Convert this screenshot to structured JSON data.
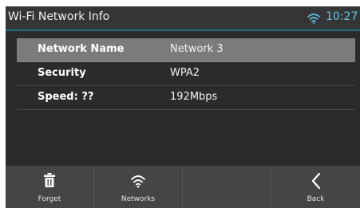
{
  "header": {
    "title": "Wi-Fi Network Info",
    "time": "10:27",
    "status_icon": "wifi-icon"
  },
  "rows": [
    {
      "label": "Network Name",
      "value": "Network 3",
      "selected": true
    },
    {
      "label": "Security",
      "value": "WPA2",
      "selected": false
    },
    {
      "label": "Speed: ??",
      "value": "192Mbps",
      "selected": false
    }
  ],
  "toolbar": {
    "forget_label": "Forget",
    "forget_icon": "trash-icon",
    "networks_label": "Networks",
    "networks_icon": "wifi-icon",
    "back_label": "Back",
    "back_icon": "chevron-left-icon"
  },
  "colors": {
    "accent": "#5ec7e9",
    "header_divider": "#1f6f86",
    "background": "#2b2b2b",
    "selected_row": "#7b7b7b",
    "toolbar": "#454545"
  }
}
